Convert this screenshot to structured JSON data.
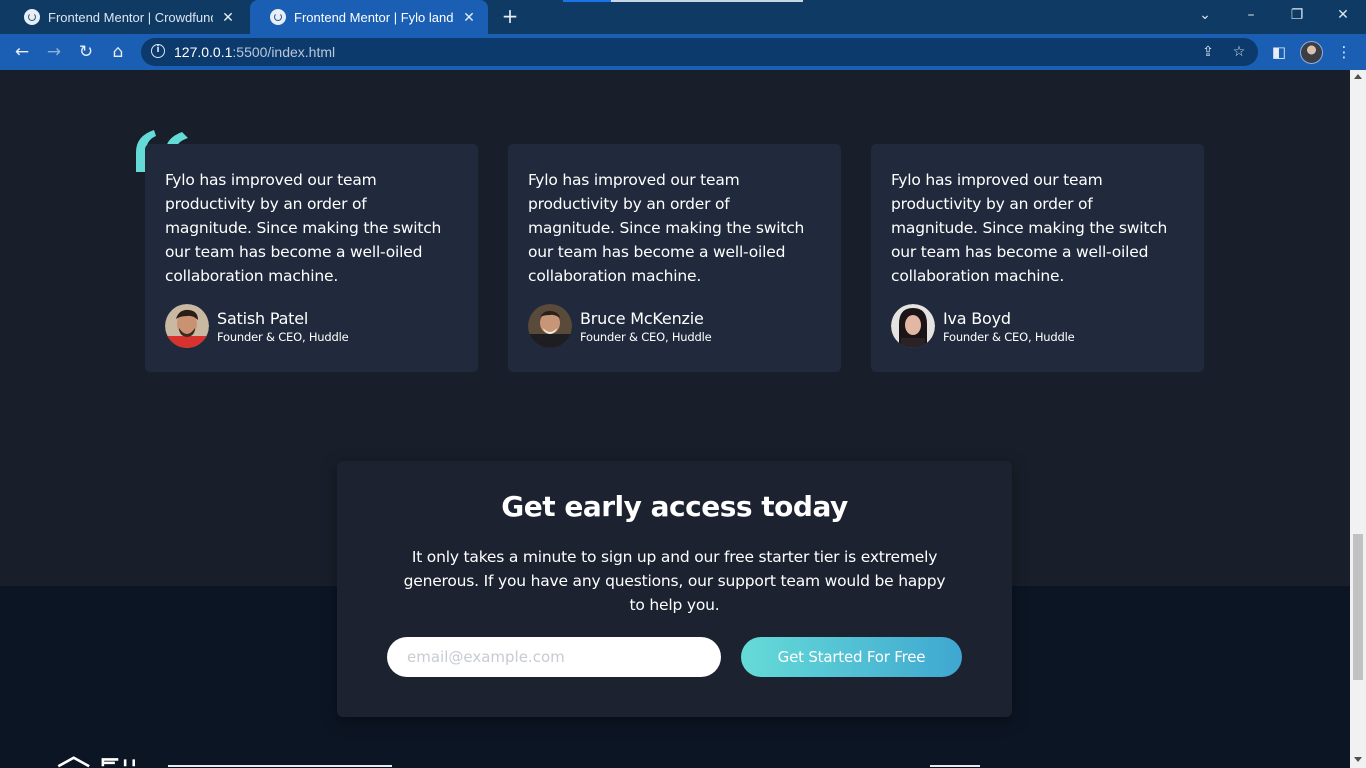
{
  "browser": {
    "tabs": [
      {
        "title": "Frontend Mentor | Crowdfunding",
        "active": false
      },
      {
        "title": "Frontend Mentor | Fylo landing p",
        "active": true
      }
    ],
    "new_tab_label": "+",
    "url": {
      "host": "127.0.0.1",
      "path": ":5500/index.html"
    }
  },
  "testimonials": [
    {
      "quote": "Fylo has improved our team productivity by an order of magnitude. Since making the switch our team has become a well-oiled collaboration machine.",
      "name": "Satish Patel",
      "role": "Founder & CEO, Huddle"
    },
    {
      "quote": "Fylo has improved our team productivity by an order of magnitude. Since making the switch our team has become a well-oiled collaboration machine.",
      "name": "Bruce McKenzie",
      "role": "Founder & CEO, Huddle"
    },
    {
      "quote": "Fylo has improved our team productivity by an order of magnitude. Since making the switch our team has become a well-oiled collaboration machine.",
      "name": "Iva Boyd",
      "role": "Founder & CEO, Huddle"
    }
  ],
  "cta": {
    "title": "Get early access today",
    "text": "It only takes a minute to sign up and our free starter tier is extremely generous. If you have any questions, our support team would be happy to help you.",
    "email_placeholder": "email@example.com",
    "button_label": "Get Started For Free"
  },
  "colors": {
    "page_bg": "#181f2a",
    "card_bg": "#202a3c",
    "footer_bg": "#0c1524",
    "accent_cyan": "#65dbd8",
    "accent_blue": "#3fa7d0",
    "chrome_blue": "#1a5fb4"
  }
}
